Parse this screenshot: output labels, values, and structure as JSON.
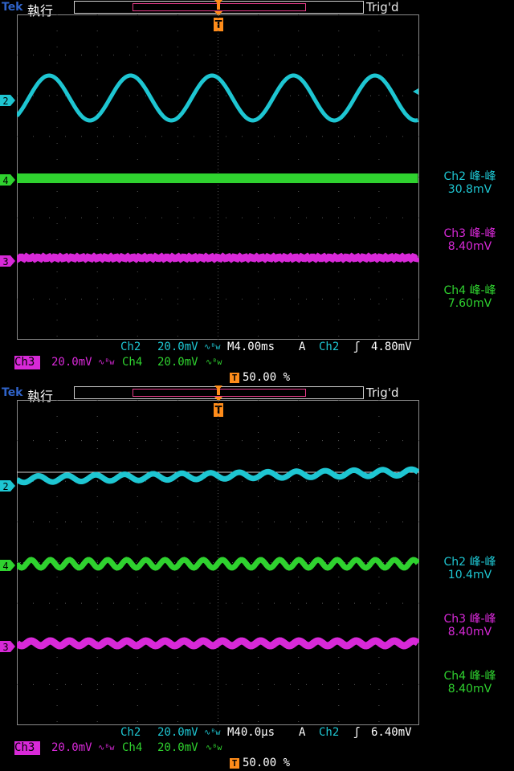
{
  "screens": [
    {
      "brand": "Tek",
      "run": "執行",
      "trig_status": "Trig'd",
      "channel_markers": [
        "2",
        "4",
        "3"
      ],
      "readouts": [
        {
          "label": "Ch2 峰-峰",
          "value": "30.8mV"
        },
        {
          "label": "Ch3 峰-峰",
          "value": "8.40mV"
        },
        {
          "label": "Ch4 峰-峰",
          "value": "7.60mV"
        }
      ],
      "status": {
        "ch2": "Ch2",
        "ch2_scale": "20.0mV",
        "timebase": "M4.00ms",
        "trig_mode": "A",
        "trig_src": "Ch2",
        "trig_level": "4.80mV",
        "ch3": "Ch3",
        "ch3_scale": "20.0mV",
        "ch4": "Ch4",
        "ch4_scale": "20.0mV",
        "trigger_pos": "50.00 %"
      }
    },
    {
      "brand": "Tek",
      "run": "執行",
      "trig_status": "Trig'd",
      "channel_markers": [
        "2",
        "4",
        "3"
      ],
      "readouts": [
        {
          "label": "Ch2 峰-峰",
          "value": "10.4mV"
        },
        {
          "label": "Ch3 峰-峰",
          "value": "8.40mV"
        },
        {
          "label": "Ch4 峰-峰",
          "value": "8.40mV"
        }
      ],
      "status": {
        "ch2": "Ch2",
        "ch2_scale": "20.0mV",
        "timebase": "M40.0µs",
        "trig_mode": "A",
        "trig_src": "Ch2",
        "trig_level": "6.40mV",
        "ch3": "Ch3",
        "ch3_scale": "20.0mV",
        "ch4": "Ch4",
        "ch4_scale": "20.0mV",
        "trigger_pos": "50.00 %"
      }
    }
  ],
  "colors": {
    "ch2": "#1ec6d2",
    "ch3": "#d829d8",
    "ch4": "#2fd22f",
    "trigger": "#ff8c1a"
  }
}
